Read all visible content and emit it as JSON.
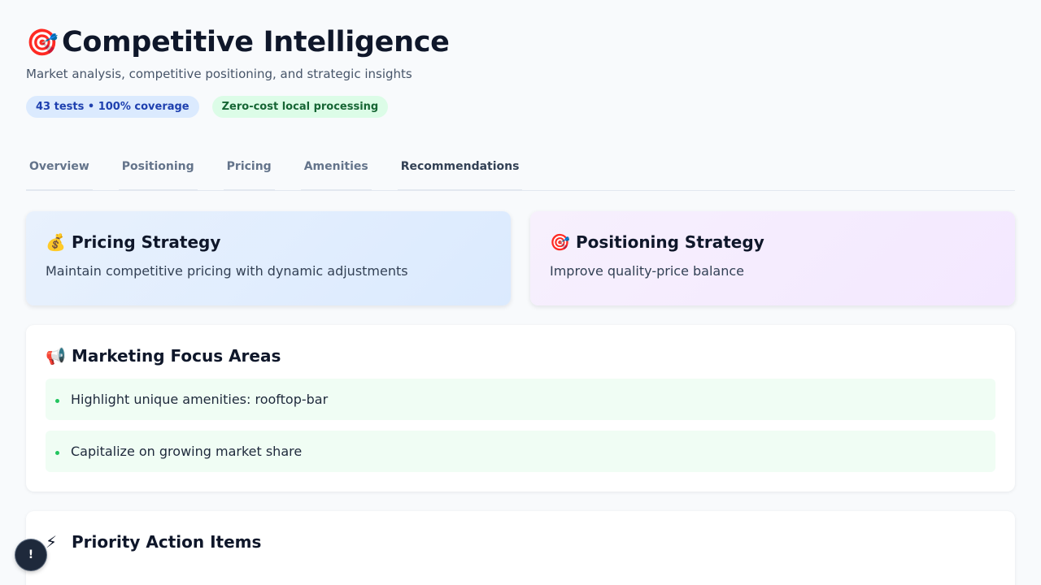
{
  "header": {
    "icon": "🎯",
    "title": "Competitive Intelligence",
    "subtitle": "Market analysis, competitive positioning, and strategic insights",
    "badges": [
      {
        "label": "43 tests • 100% coverage",
        "color": "#1e40af"
      },
      {
        "label": "Zero-cost local processing",
        "color": "#166534"
      }
    ]
  },
  "tabs": [
    {
      "label": "Overview"
    },
    {
      "label": "Positioning"
    },
    {
      "label": "Pricing"
    },
    {
      "label": "Amenities"
    },
    {
      "label": "Recommendations",
      "active": true
    }
  ],
  "strategies": [
    {
      "icon": "💰",
      "icon_name": "money-bag-icon",
      "title": "Pricing Strategy",
      "text": "Maintain competitive pricing with dynamic adjustments"
    },
    {
      "icon": "🎯",
      "icon_name": "target-icon",
      "title": "Positioning Strategy",
      "text": "Improve quality-price balance"
    }
  ],
  "marketing": {
    "icon": "📢",
    "icon_name": "megaphone-icon",
    "title": "Marketing Focus Areas",
    "items": [
      "Highlight unique amenities: rooftop-bar",
      "Capitalize on growing market share"
    ]
  },
  "priority": {
    "icon": "⚡",
    "icon_name": "lightning-icon",
    "title": "Priority Action Items"
  },
  "fab": {
    "label": "!",
    "icon_name": "alert-icon"
  }
}
